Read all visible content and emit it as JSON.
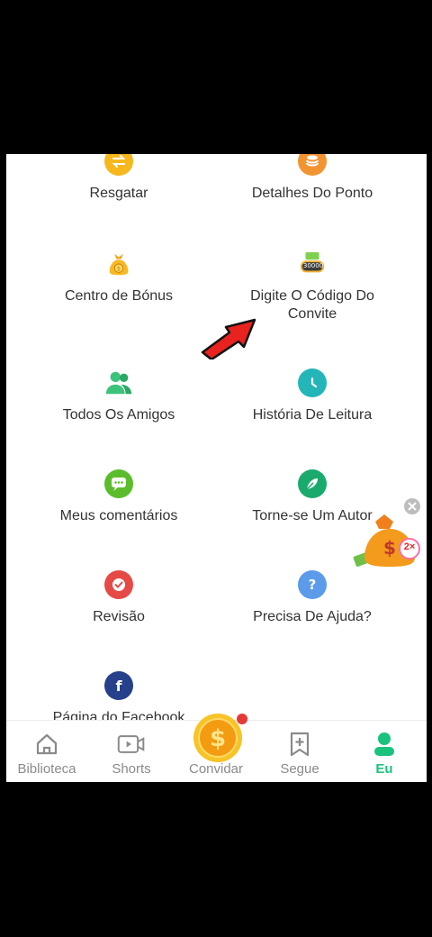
{
  "menu": {
    "resgatar": "Resgatar",
    "detalhes_ponto": "Detalhes Do Ponto",
    "centro_bonus": "Centro de Bónus",
    "digite_codigo": "Digite O Código Do Convite",
    "digite_codigo_badge": "30000",
    "todos_amigos": "Todos Os Amigos",
    "historia_leitura": "História De Leitura",
    "meus_comentarios": "Meus comentários",
    "torne_se_autor": "Torne-se Um Autor",
    "revisao": "Revisão",
    "precisa_ajuda": "Precisa De Ajuda?",
    "facebook_partial": "Página do Facebook"
  },
  "floating": {
    "multiplier": "2×"
  },
  "tabs": {
    "biblioteca": "Biblioteca",
    "shorts": "Shorts",
    "convidar": "Convidar",
    "segue": "Segue",
    "eu": "Eu"
  },
  "colors": {
    "accent": "#19c37d",
    "orange": "#f39c12",
    "teal": "#26b5b5",
    "red": "#e74c3c",
    "blue": "#4a90e2"
  }
}
